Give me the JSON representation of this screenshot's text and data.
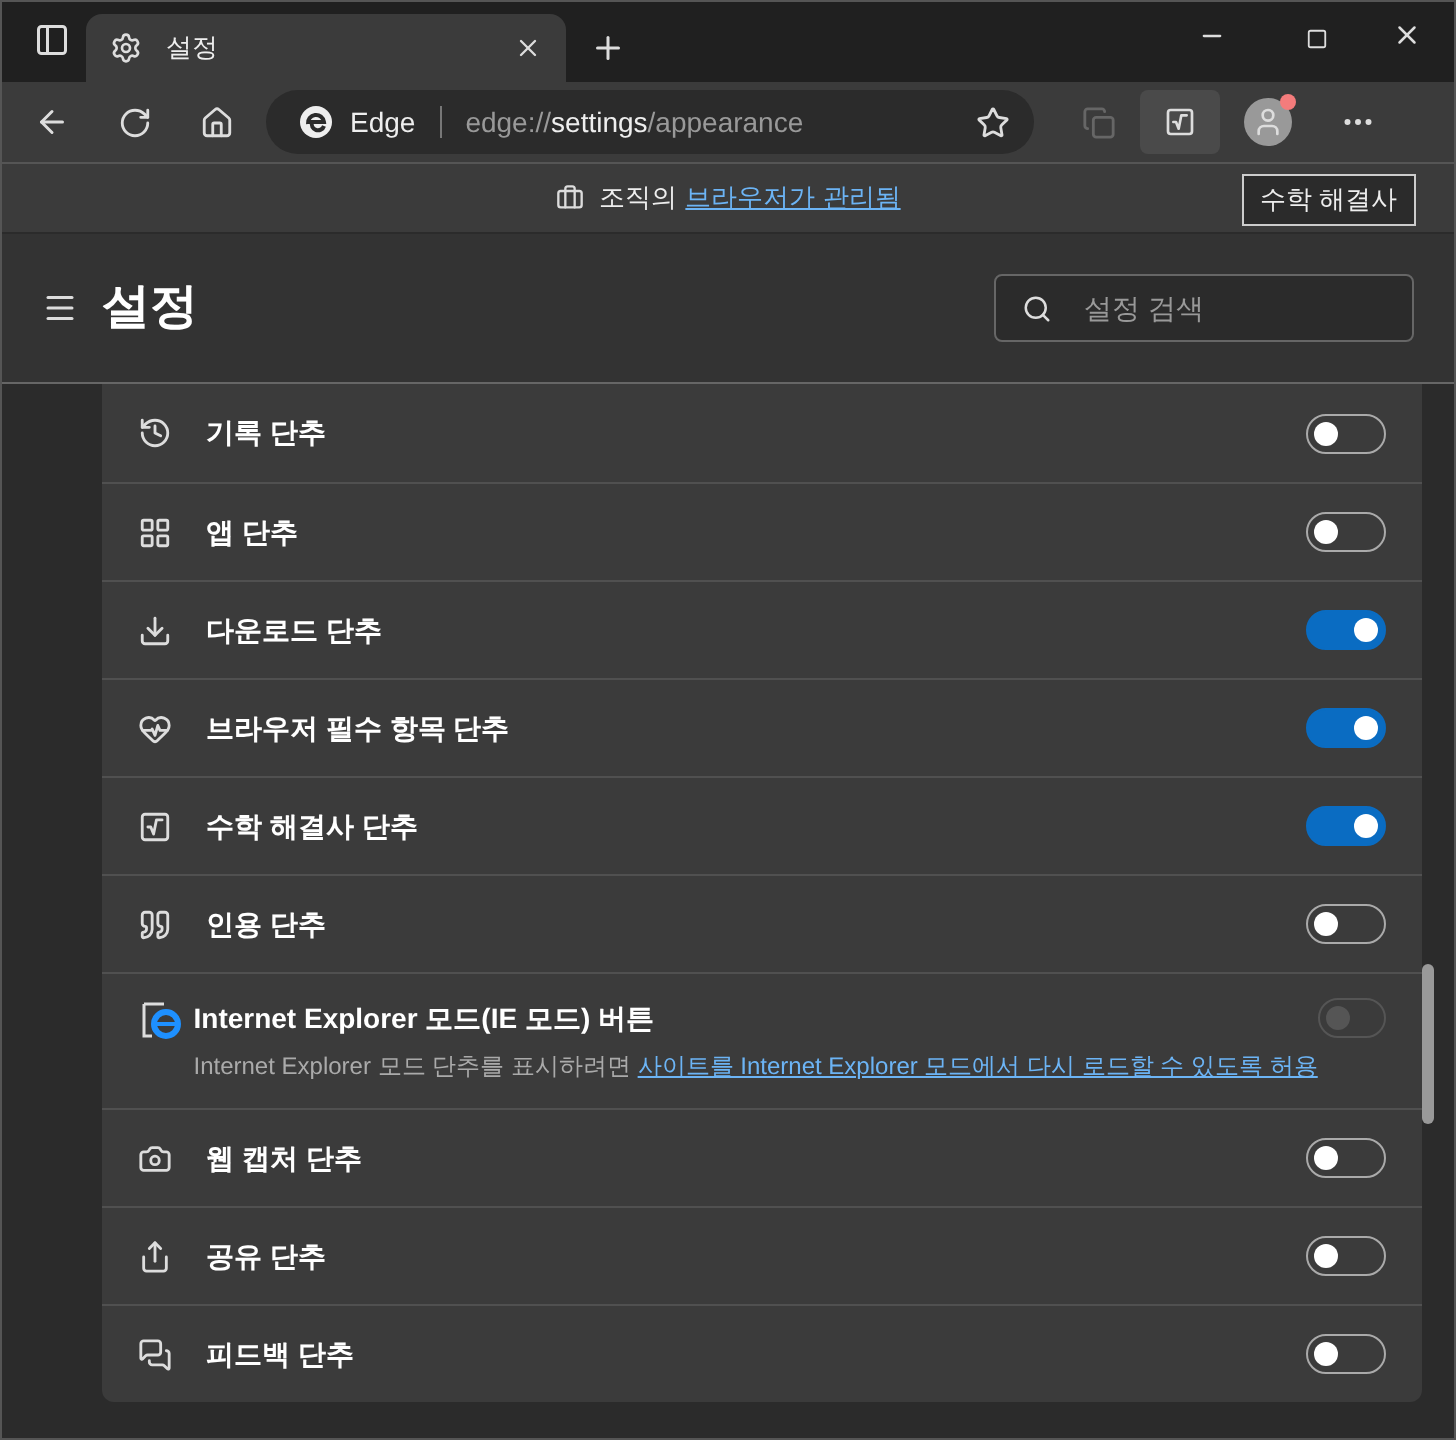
{
  "tab": {
    "title": "설정",
    "selected": true
  },
  "address": {
    "site": "Edge",
    "url_prefix": "edge://",
    "url_main": "settings",
    "url_suffix": "/appearance"
  },
  "tooltip": "수학 해결사",
  "info_bar": {
    "text": "조직의",
    "link": "브라우저가 관리됨"
  },
  "header": {
    "title": "설정",
    "search_placeholder": "설정 검색"
  },
  "items": [
    {
      "kind": "toggle",
      "label": "기록 단추",
      "on": false,
      "disabled": false
    },
    {
      "kind": "toggle",
      "label": "앱 단추",
      "on": false,
      "disabled": false
    },
    {
      "kind": "toggle",
      "label": "다운로드 단추",
      "on": true,
      "disabled": false
    },
    {
      "kind": "toggle",
      "label": "브라우저 필수 항목 단추",
      "on": true,
      "disabled": false
    },
    {
      "kind": "toggle",
      "label": "수학 해결사 단추",
      "on": true,
      "disabled": false
    },
    {
      "kind": "toggle",
      "label": "인용 단추",
      "on": false,
      "disabled": false
    },
    {
      "kind": "described",
      "label": "Internet Explorer 모드(IE 모드) 버튼",
      "on": false,
      "disabled": true,
      "description": "Internet Explorer 모드 단추를 표시하려면",
      "link": "사이트를 Internet Explorer 모드에서 다시 로드할 수 있도록 허용"
    },
    {
      "kind": "toggle",
      "label": "웹 캡처 단추",
      "on": false,
      "disabled": false
    },
    {
      "kind": "toggle",
      "label": "공유 단추",
      "on": false,
      "disabled": false
    },
    {
      "kind": "toggle",
      "label": "피드백 단추",
      "on": false,
      "disabled": false
    }
  ]
}
